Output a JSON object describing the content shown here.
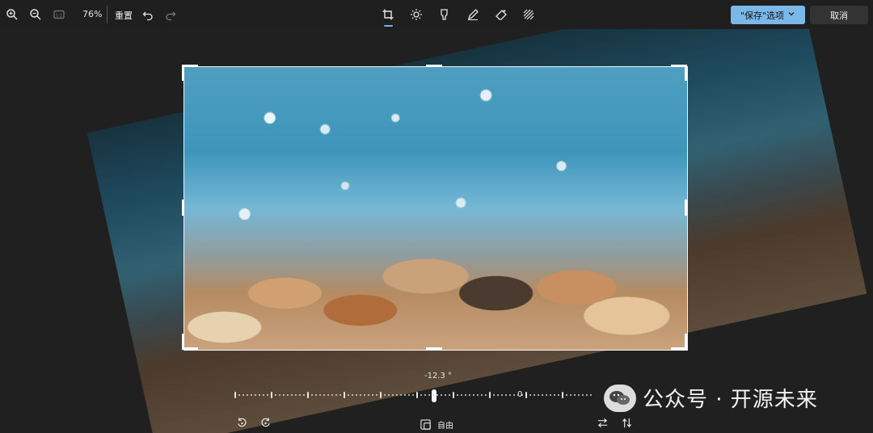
{
  "toolbar": {
    "zoom_level": "76%",
    "reset_label": "重置",
    "save_label": "\"保存\"选项",
    "cancel_label": "取消"
  },
  "editor": {
    "rotation_readout": "-12.3 °",
    "dial_zero_label": "0",
    "aspect_label": "自由"
  },
  "watermark": {
    "text": "公众号 · 开源未来"
  },
  "colors": {
    "accent": "#7ab8ea",
    "background": "#202020"
  },
  "icons": [
    "zoom-in-icon",
    "zoom-out-icon",
    "fit-screen-icon",
    "undo-icon",
    "redo-icon",
    "crop-icon",
    "brightness-icon",
    "markup-icon",
    "draw-icon",
    "erase-icon",
    "filter-icon",
    "chevron-down-icon",
    "rotate-left-icon",
    "rotate-right-icon",
    "flip-horizontal-icon",
    "flip-vertical-icon",
    "aspect-ratio-icon",
    "wechat-logo"
  ]
}
